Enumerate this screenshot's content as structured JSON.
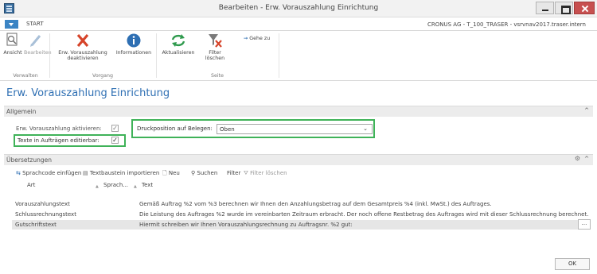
{
  "window": {
    "title": "Bearbeiten - Erw. Vorauszahlung Einrichtung",
    "controls": [
      "minimize-icon",
      "maximize-icon",
      "close-icon"
    ]
  },
  "tabs": {
    "start_label": "START"
  },
  "company": "CRONUS AG - T_100_TRASER - vsrvnav2017.traser.intern",
  "ribbon": {
    "ansicht": "Ansicht",
    "bearbeiten": "Bearbeiten",
    "deactivate_line1": "Erw. Vorauszahlung",
    "deactivate_line2": "deaktivieren",
    "informationen": "Informationen",
    "aktualisieren": "Aktualisieren",
    "filter_line1": "Filter",
    "filter_line2": "löschen",
    "gehe_zu": "Gehe zu",
    "groups": {
      "verwalten": "Verwalten",
      "vorgang": "Vorgang",
      "seite": "Seite"
    }
  },
  "page_title": "Erw. Vorauszahlung Einrichtung",
  "general": {
    "header": "Allgemein",
    "activate_label": "Erw. Vorauszahlung aktivieren:",
    "activate_checked": true,
    "editable_label": "Texte in Aufträgen editierbar:",
    "editable_checked": true,
    "print_position_label": "Druckposition auf Belegen:",
    "print_position_value": "Oben"
  },
  "translations": {
    "header": "Übersetzungen",
    "toolbar": {
      "insert_language": "Sprachcode einfügen",
      "import_text": "Textbaustein importieren",
      "new": "Neu",
      "search": "Suchen",
      "filter": "Filter",
      "clear_filter": "Filter löschen"
    },
    "columns": {
      "art": "Art",
      "sprach": "Sprach...",
      "text": "Text"
    },
    "rows": [
      {
        "art": "Vorauszahlungstext",
        "text": "Gemäß Auftrag %2 vom %3 berechnen wir Ihnen den Anzahlungsbetrag auf dem Gesamtpreis %4 (inkl. MwSt.) des Auftrages."
      },
      {
        "art": "Schlussrechnungstext",
        "text": "Die Leistung des Auftrages %2 wurde im vereinbarten Zeitraum erbracht. Der noch offene Restbetrag des Auftrages wird mit dieser Schlussrechnung berechnet."
      },
      {
        "art": "Gutschriftstext",
        "text": "Hiermit schreiben wir Ihnen Vorauszahlungsrechnung zu Auftragsnr. %2 gut:",
        "button": "..."
      }
    ]
  },
  "ok_label": "OK",
  "colors": {
    "accent": "#2e6fb3",
    "highlight": "#3fb258",
    "close": "#c75050"
  }
}
